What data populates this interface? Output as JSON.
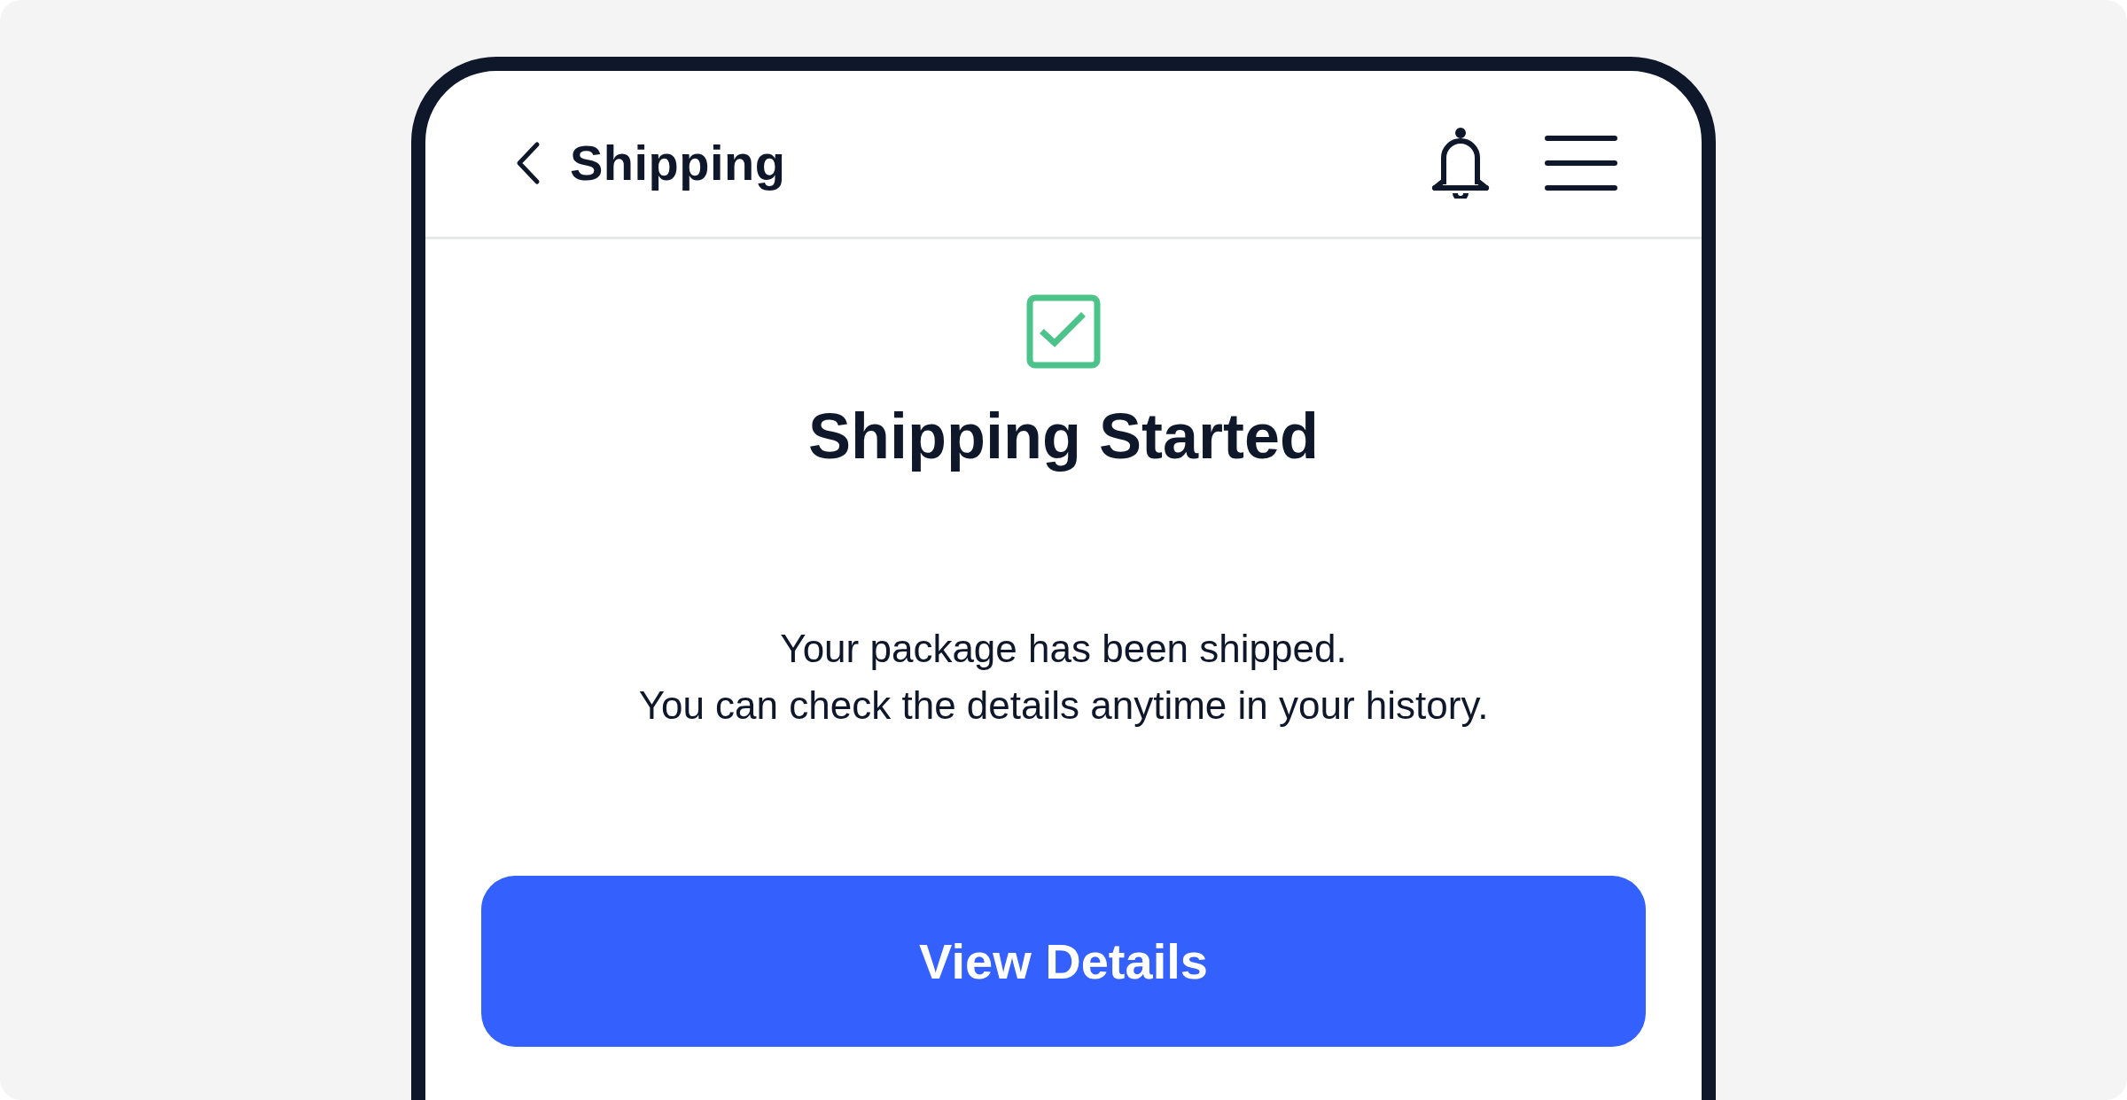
{
  "header": {
    "title": "Shipping"
  },
  "status": {
    "title": "Shipping Started",
    "lines": [
      "Your package has been shipped.",
      "You can check the details anytime in your history."
    ]
  },
  "primary_button": {
    "label": "View Details"
  }
}
